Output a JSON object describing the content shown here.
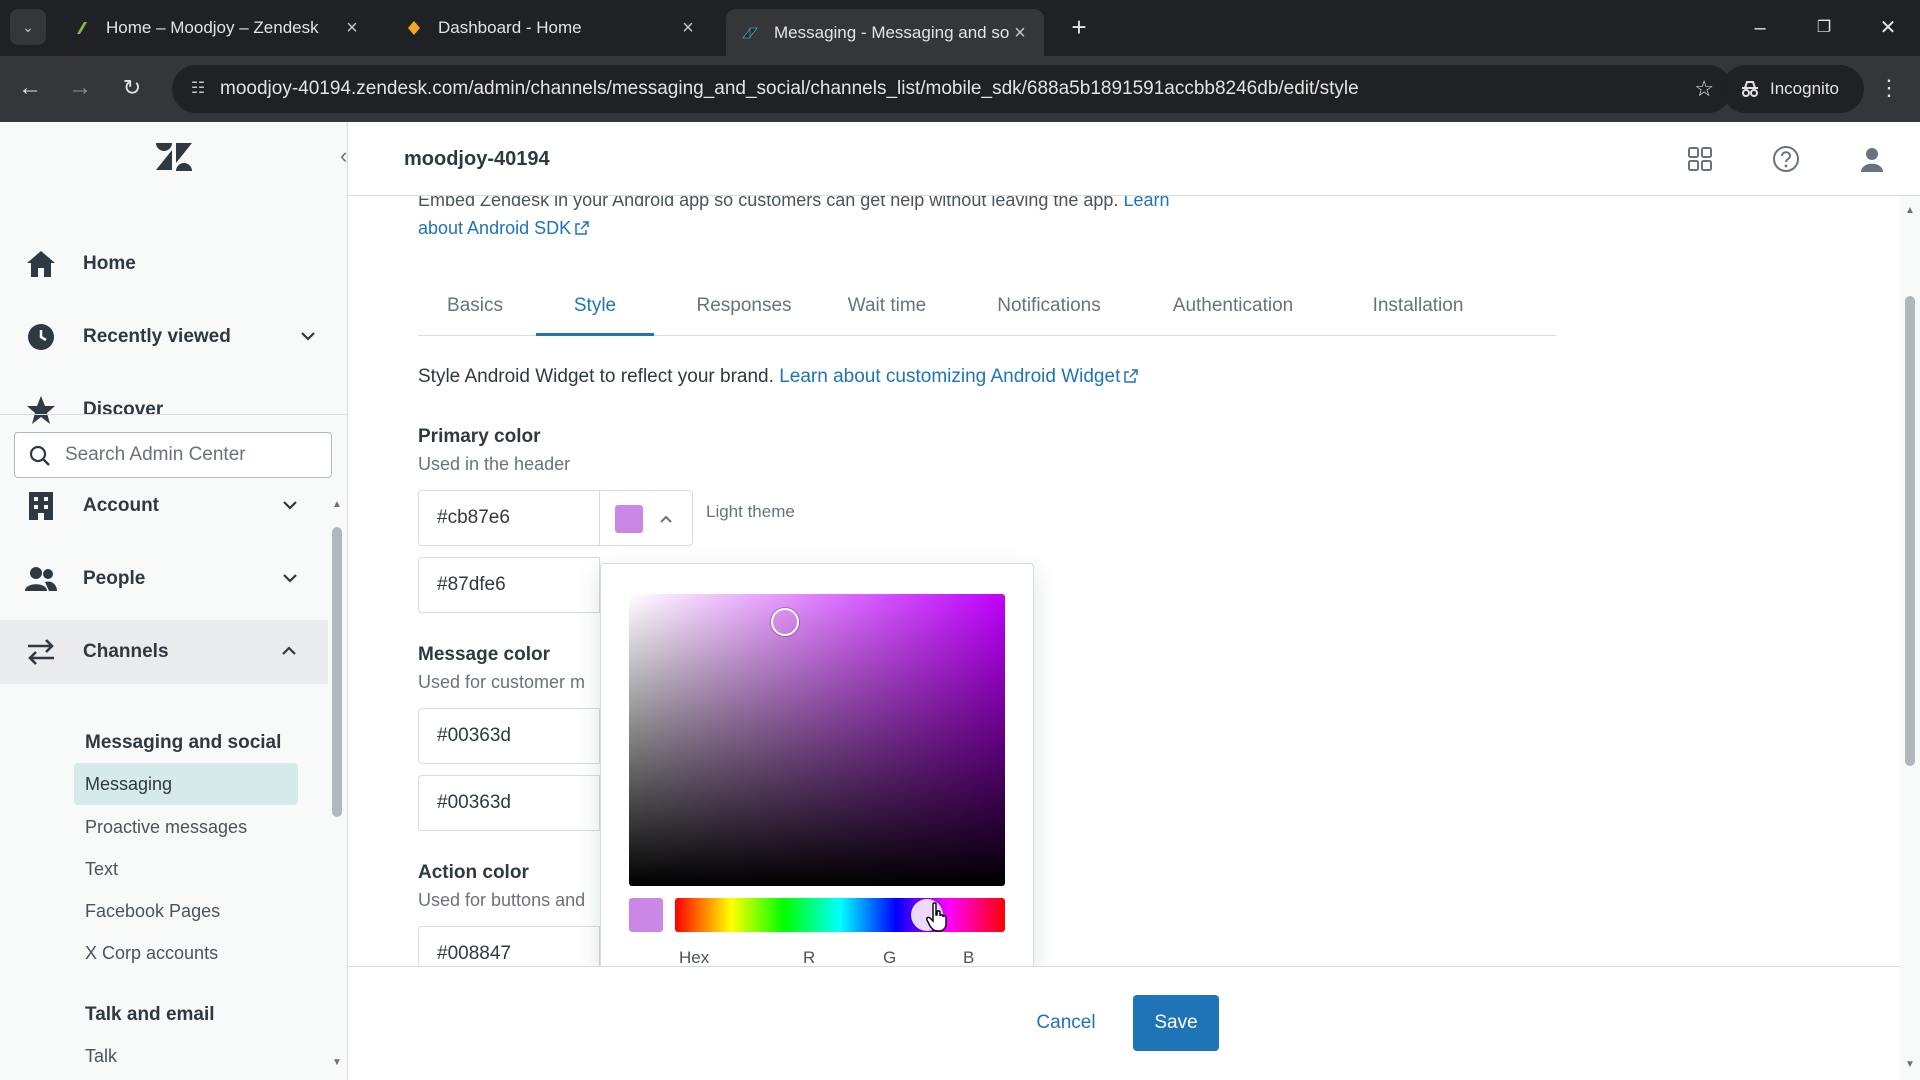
{
  "browser": {
    "tabs": [
      {
        "title": "Home – Moodjoy – Zendesk"
      },
      {
        "title": "Dashboard - Home"
      },
      {
        "title": "Messaging - Messaging and so"
      }
    ],
    "url": "moodjoy-40194.zendesk.com/admin/channels/messaging_and_social/channels_list/mobile_sdk/688a5b1891591accbb8246db/edit/style",
    "incognito_label": "Incognito"
  },
  "header": {
    "account_name": "moodjoy-40194"
  },
  "sidebar": {
    "top_items": [
      {
        "label": "Home",
        "icon": "home-icon"
      },
      {
        "label": "Recently viewed",
        "icon": "clock-icon"
      },
      {
        "label": "Discover",
        "icon": "star-icon"
      }
    ],
    "search_placeholder": "Search Admin Center",
    "sections": [
      {
        "label": "Account",
        "icon": "building-icon"
      },
      {
        "label": "People",
        "icon": "people-icon"
      },
      {
        "label": "Channels",
        "icon": "channels-icon"
      }
    ],
    "group_messaging": "Messaging and social",
    "messaging_items": [
      "Messaging",
      "Proactive messages",
      "Text",
      "Facebook Pages",
      "X Corp accounts"
    ],
    "group_talk": "Talk and email",
    "talk_items": [
      "Talk"
    ]
  },
  "main": {
    "intro_text": "Embed Zendesk in your Android app so customers can get help without leaving the app.",
    "intro_link_a": "Learn",
    "intro_link_b": "about Android SDK",
    "tabs": [
      "Basics",
      "Style",
      "Responses",
      "Wait time",
      "Notifications",
      "Authentication",
      "Installation"
    ],
    "active_tab": "Style",
    "description": "Style Android Widget to reflect your brand.",
    "description_link": "Learn about customizing Android Widget",
    "primary": {
      "label": "Primary color",
      "hint": "Used in the header",
      "light_value": "#cb87e6",
      "dark_value": "#87dfe6",
      "theme_label": "Light theme"
    },
    "message": {
      "label": "Message color",
      "hint": "Used for customer m",
      "light_value": "#00363d",
      "dark_value": "#00363d"
    },
    "action": {
      "label": "Action color",
      "hint": "Used for buttons and",
      "light_value": "#008847"
    }
  },
  "picker": {
    "channel_labels": [
      "Hex",
      "R",
      "G",
      "B"
    ],
    "selected_color": "#cb87e6"
  },
  "footer": {
    "cancel_label": "Cancel",
    "save_label": "Save"
  },
  "colors": {
    "accent": "#1f73b7",
    "brand_primary": "#cb87e6",
    "sidebar_active": "#d6eaea"
  }
}
